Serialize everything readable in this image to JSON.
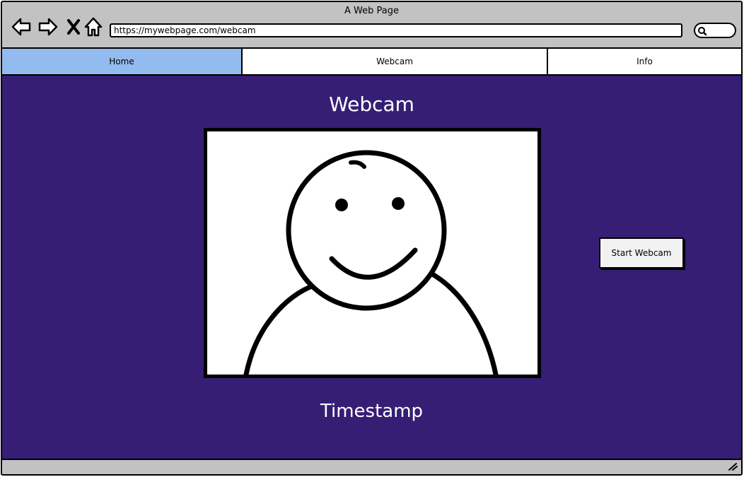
{
  "window": {
    "title": "A Web Page"
  },
  "toolbar": {
    "icons": [
      "back-arrow-icon",
      "forward-arrow-icon",
      "close-icon",
      "home-icon"
    ],
    "url": "https://mywebpage.com/webcam",
    "search_icon": "search-icon"
  },
  "tabs": [
    {
      "label": "Home",
      "active": true
    },
    {
      "label": "Webcam",
      "active": false
    },
    {
      "label": "Info",
      "active": false
    }
  ],
  "main": {
    "heading": "Webcam",
    "webcam_image": "smiley-person-placeholder",
    "start_button_label": "Start Webcam",
    "timestamp_label": "Timestamp"
  },
  "colors": {
    "content_background": "#361e75",
    "active_tab": "#94bbef",
    "chrome": "#c2c2c2"
  }
}
